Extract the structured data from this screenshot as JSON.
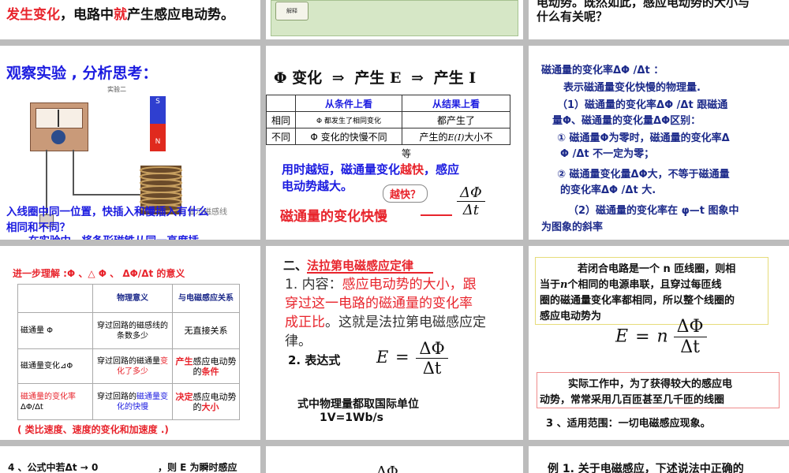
{
  "slides": {
    "s1": {
      "l1": "发生变化",
      "l2": "，电路中",
      "l3": "就",
      "l4": "产生感应电动势。"
    },
    "s2": {
      "sign": "解释"
    },
    "s3": {
      "l1": "电动势。既然如此，感应电动势的大小与",
      "l2": "什么有关呢？"
    },
    "s4": {
      "title": "观察实验 , 分析思考：",
      "exp_label": "实验二",
      "magnet_s": "S",
      "magnet_n": "N",
      "meter_label": "显示磁感线",
      "q1": "在实验中，将条形磁铁从同一高度插",
      "q2": "入线圈中同一位置，快插入和慢插入有什么",
      "q3": "相同和不同？"
    },
    "s5": {
      "head_phi": "Φ 变化",
      "head_arrow1": "⇒",
      "head_e": "产生 E",
      "head_arrow2": "⇒",
      "head_i": "产生 I",
      "th1": "从条件上看",
      "th2": "从结果上看",
      "r1c1": "相同",
      "r1c2": "Φ 都发生了相同变化",
      "r1c3": "都产生了",
      "r2c1": "不同",
      "r2c2": "Φ 变化的快慢不同",
      "r2c3": "产生的",
      "r2c3_sym": "E(I)",
      "r2c3_tail": "大小不",
      "r2c3_overflow": "等",
      "ann_pre": "用时越短，磁通量变化",
      "ann_red": "越快",
      "ann_post": "，感应",
      "ann_l2": "电动势越大。",
      "bubble": "越快？",
      "rate": "磁通量的变化快慢",
      "frac_num": "ΔΦ",
      "frac_den": "Δt"
    },
    "s6": {
      "title": "磁通量的变化率ΔΦ /Δt  ：",
      "l1": "表示磁通量变化快慢的物理量.",
      "l2": "（1）磁通量的变化率ΔΦ /Δt 跟磁通",
      "l3": "量Φ、磁通量的变化量ΔΦ区别：",
      "l4": "① 磁通量Φ为零时，磁通量的变化率Δ",
      "l5": "Φ /Δt 不一定为零；",
      "l6": "② 磁通量变化量ΔΦ大，不等于磁通量",
      "l7": "的变化率ΔΦ /Δt 大.",
      "l8": "（2）磁通量的变化率在 φ—t 图象中",
      "l9": "为图象的斜率"
    },
    "s7": {
      "title": "进一步理解 :Φ 、△ Φ 、 ΔΦ/Δt 的意义",
      "h1": "物理意义",
      "h2": "与电磁感应关系",
      "r1a": "磁通量 Φ",
      "r1b": "穿过回路的磁感线的条数多少",
      "r1c": "无直接关系",
      "r2a": "磁通量变化⊿Φ",
      "r2b_pre": "穿过回路的磁通量",
      "r2b_red": "变化了多少",
      "r2c_red": "产生",
      "r2c_mid": "感应电动势的",
      "r2c_red2": "条件",
      "r3a": "磁通量的变化率",
      "r3a2": "ΔΦ/Δt",
      "r3b_pre": "穿过回路的",
      "r3b_blue": "磁通量变化的快慢",
      "r3c_red": "决定",
      "r3c_mid": "感应电动势的",
      "r3c_red2": "大小",
      "note": "( 类比速度、速度的变化和加速度 .)"
    },
    "s8": {
      "title_pre": "二、",
      "title_red": "法拉第电磁感应定律",
      "c1": "1. 内容：",
      "c1_red": "感应电动势的大小，跟",
      "c2_red": "穿过这一电路的磁通量的变化率",
      "c3_red": "成正比",
      "c3": "。这就是法拉第电磁感应定",
      "c4": "律。",
      "expr_label": "2. 表达式",
      "e": "E",
      "eq": "=",
      "num": "ΔΦ",
      "den": "Δt",
      "unit1": "式中物理量都取国际单位",
      "unit2": "1V=1Wb/s"
    },
    "s9": {
      "p1": "若闭合电路是一个 n 匝线圈，则相",
      "p2_pre": "当于",
      "p2_n": "n",
      "p2_post": "个相同的电源串联，且穿过每匝线",
      "p3": "圈的磁通量变化率都相同，所以整个线圈的",
      "p4": "感应电动势为",
      "e": "E",
      "eq": "=",
      "n": "n",
      "num": "ΔΦ",
      "den": "Δt",
      "w1": "实际工作中，为了获得较大的感应电",
      "w2": "动势，常常采用几百匝甚至几千匝的线圈",
      "scope": "3 、适用范围：一切电磁感应现象。"
    },
    "s10": {
      "t1": "4 、公式中若Δt → 0",
      "t2": "，则 E 为瞬时感应"
    },
    "s11": {
      "t": "ΔΦ"
    },
    "s12": {
      "t": "例 1. 关于电磁感应，下述说法中正确的"
    }
  }
}
